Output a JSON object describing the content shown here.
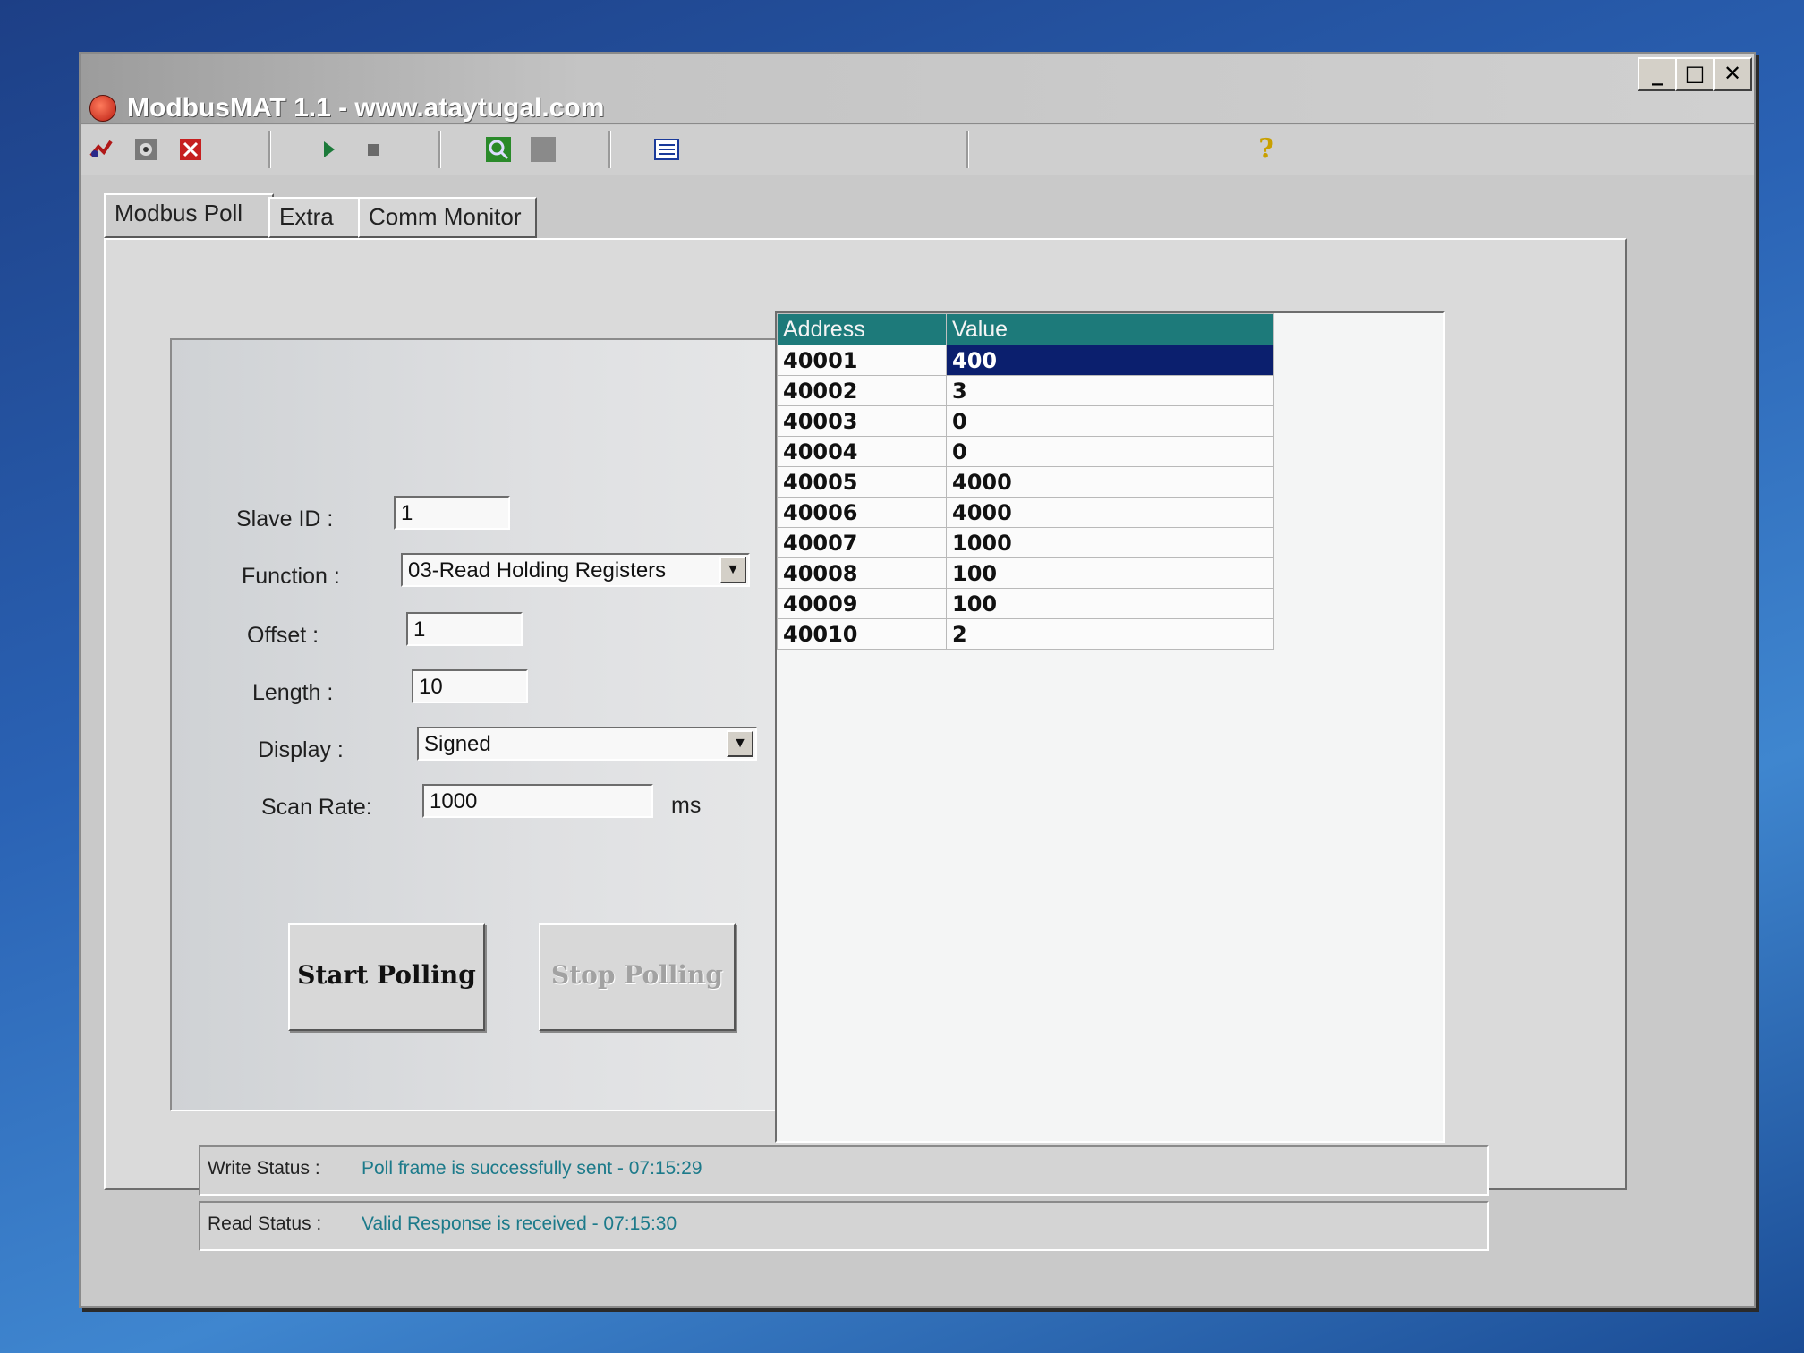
{
  "window": {
    "title": "ModbusMAT 1.1  -  www.ataytugal.com",
    "controls": {
      "minimize": "_",
      "maximize": "□",
      "close": "✕"
    }
  },
  "toolbar": {
    "icons": [
      "connect-icon",
      "settings-icon",
      "disconnect-icon",
      "play-icon",
      "stop-icon",
      "search-icon",
      "square-icon",
      "list-icon",
      "help-icon"
    ],
    "help_label": "?"
  },
  "tabs": [
    {
      "label": "Modbus Poll",
      "active": true
    },
    {
      "label": "Extra",
      "active": false
    },
    {
      "label": "Comm Monitor",
      "active": false
    }
  ],
  "form": {
    "slave_id_label": "Slave ID :",
    "slave_id_value": "1",
    "function_label": "Function :",
    "function_value": "03-Read Holding Registers",
    "offset_label": "Offset :",
    "offset_value": "1",
    "length_label": "Length :",
    "length_value": "10",
    "display_label": "Display :",
    "display_value": "Signed",
    "scan_rate_label": "Scan Rate:",
    "scan_rate_value": "1000",
    "scan_rate_unit": "ms"
  },
  "buttons": {
    "start": "Start Polling",
    "stop": "Stop Polling"
  },
  "grid": {
    "headers": [
      "Address",
      "Value"
    ],
    "rows": [
      {
        "address": "40001",
        "value": "400"
      },
      {
        "address": "40002",
        "value": "3"
      },
      {
        "address": "40003",
        "value": "0"
      },
      {
        "address": "40004",
        "value": "0"
      },
      {
        "address": "40005",
        "value": "4000"
      },
      {
        "address": "40006",
        "value": "4000"
      },
      {
        "address": "40007",
        "value": "1000"
      },
      {
        "address": "40008",
        "value": "100"
      },
      {
        "address": "40009",
        "value": "100"
      },
      {
        "address": "40010",
        "value": "2"
      }
    ],
    "selected_row": 0
  },
  "status": {
    "write_label": "Write Status :",
    "write_text": "Poll frame is successfully sent - 07:15:29",
    "read_label": "Read Status :",
    "read_text": "Valid Response is received - 07:15:30"
  },
  "colors": {
    "grid_header": "#1d7a7a",
    "selection": "#0b1f6e",
    "status_text": "#1c7a8a"
  }
}
